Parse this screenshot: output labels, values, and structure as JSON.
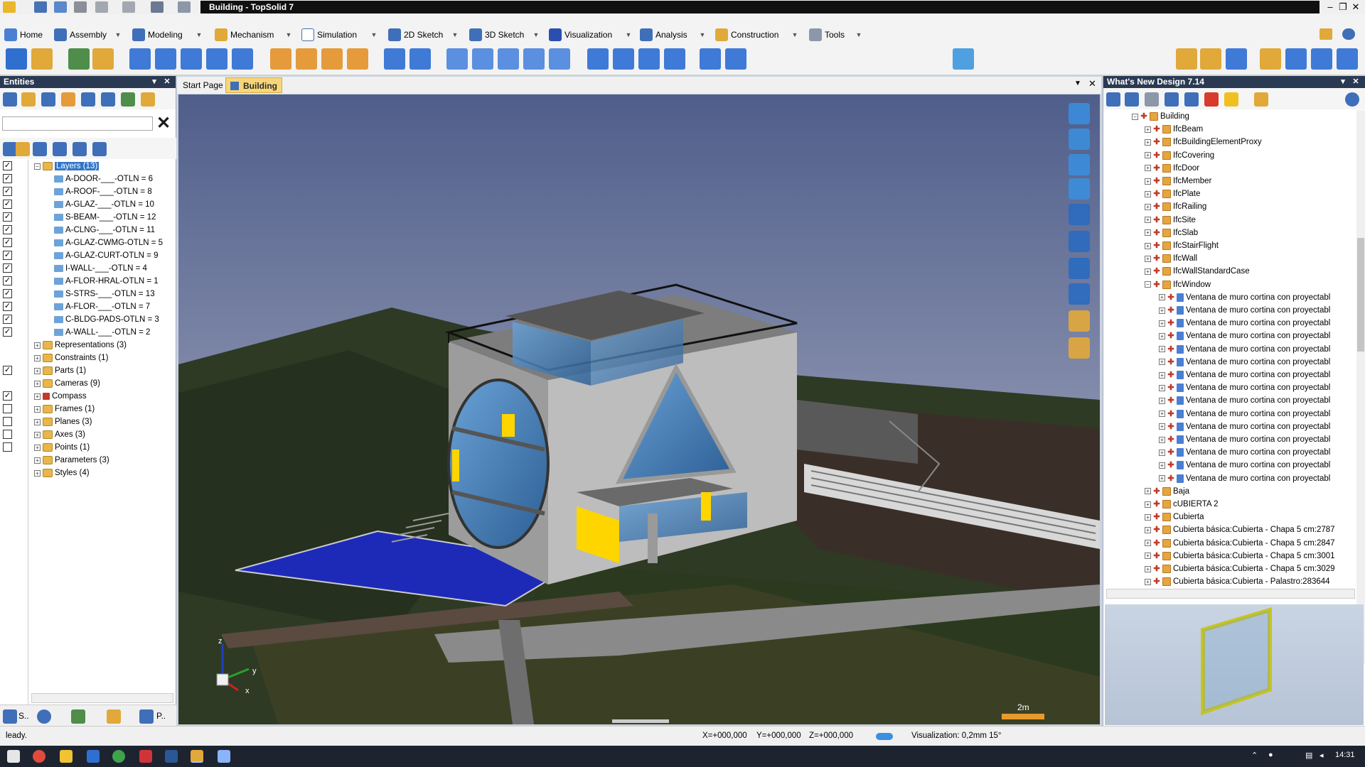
{
  "window": {
    "title": "Building - TopSolid 7",
    "controls": [
      "–",
      "❐",
      "✕"
    ]
  },
  "ribbon": {
    "tabs": [
      {
        "label": "Home"
      },
      {
        "label": "Assembly"
      },
      {
        "label": "Modeling"
      },
      {
        "label": "Mechanism"
      },
      {
        "label": "Simulation"
      },
      {
        "label": "2D Sketch"
      },
      {
        "label": "3D Sketch"
      },
      {
        "label": "Visualization"
      },
      {
        "label": "Analysis"
      },
      {
        "label": "Construction"
      },
      {
        "label": "Tools"
      }
    ]
  },
  "entities_panel": {
    "title": "Entities",
    "search_value": "",
    "tree": [
      {
        "label": "Layers (13)",
        "type": "folder",
        "expanded": true,
        "selected": true,
        "checked": true
      },
      {
        "label": "A-DOOR-___-OTLN = 6",
        "type": "layer",
        "checked": true
      },
      {
        "label": "A-ROOF-___-OTLN = 8",
        "type": "layer",
        "checked": true
      },
      {
        "label": "A-GLAZ-___-OTLN = 10",
        "type": "layer",
        "checked": true
      },
      {
        "label": "S-BEAM-___-OTLN = 12",
        "type": "layer",
        "checked": true
      },
      {
        "label": "A-CLNG-___-OTLN = 11",
        "type": "layer",
        "checked": true
      },
      {
        "label": "A-GLAZ-CWMG-OTLN = 5",
        "type": "layer",
        "checked": true
      },
      {
        "label": "A-GLAZ-CURT-OTLN = 9",
        "type": "layer",
        "checked": true
      },
      {
        "label": "I-WALL-___-OTLN = 4",
        "type": "layer",
        "checked": true
      },
      {
        "label": "A-FLOR-HRAL-OTLN = 1",
        "type": "layer",
        "checked": true
      },
      {
        "label": "S-STRS-___-OTLN = 13",
        "type": "layer",
        "checked": true
      },
      {
        "label": "A-FLOR-___-OTLN = 7",
        "type": "layer",
        "checked": true
      },
      {
        "label": "C-BLDG-PADS-OTLN = 3",
        "type": "layer",
        "checked": true
      },
      {
        "label": "A-WALL-___-OTLN = 2",
        "type": "layer",
        "checked": true
      },
      {
        "label": "Representations (3)",
        "type": "folder",
        "checked": null
      },
      {
        "label": "Constraints (1)",
        "type": "folder",
        "checked": null
      },
      {
        "label": "Parts (1)",
        "type": "folder",
        "checked": true
      },
      {
        "label": "Cameras (9)",
        "type": "folder",
        "checked": null
      },
      {
        "label": "Compass",
        "type": "compass",
        "checked": true
      },
      {
        "label": "Frames (1)",
        "type": "folder",
        "checked": false
      },
      {
        "label": "Planes (3)",
        "type": "folder",
        "checked": false
      },
      {
        "label": "Axes (3)",
        "type": "folder",
        "checked": false
      },
      {
        "label": "Points (1)",
        "type": "folder",
        "checked": false
      },
      {
        "label": "Parameters (3)",
        "type": "folder",
        "checked": null
      },
      {
        "label": "Styles (4)",
        "type": "folder",
        "checked": null
      }
    ],
    "bottom_tabs": [
      "S..",
      "...",
      "...",
      "...",
      "P.."
    ]
  },
  "document_tabs": [
    {
      "label": "Start Page",
      "active": false
    },
    {
      "label": "Building",
      "active": true
    }
  ],
  "right_panel": {
    "title": "What's New Design 7.14",
    "tree": [
      {
        "label": "Building",
        "level": 0,
        "kind": "ifc"
      },
      {
        "label": "IfcBeam",
        "level": 1,
        "kind": "ifc"
      },
      {
        "label": "IfcBuildingElementProxy",
        "level": 1,
        "kind": "ifc"
      },
      {
        "label": "IfcCovering",
        "level": 1,
        "kind": "ifc"
      },
      {
        "label": "IfcDoor",
        "level": 1,
        "kind": "ifc"
      },
      {
        "label": "IfcMember",
        "level": 1,
        "kind": "ifc"
      },
      {
        "label": "IfcPlate",
        "level": 1,
        "kind": "ifc"
      },
      {
        "label": "IfcRailing",
        "level": 1,
        "kind": "ifc"
      },
      {
        "label": "IfcSite",
        "level": 1,
        "kind": "ifc"
      },
      {
        "label": "IfcSlab",
        "level": 1,
        "kind": "ifc"
      },
      {
        "label": "IfcStairFlight",
        "level": 1,
        "kind": "ifc"
      },
      {
        "label": "IfcWall",
        "level": 1,
        "kind": "ifc"
      },
      {
        "label": "IfcWallStandardCase",
        "level": 1,
        "kind": "ifc"
      },
      {
        "label": "IfcWindow",
        "level": 1,
        "kind": "ifc"
      },
      {
        "label": "Ventana de muro cortina con proyectabl",
        "level": 2,
        "kind": "obj"
      },
      {
        "label": "Ventana de muro cortina con proyectabl",
        "level": 2,
        "kind": "obj"
      },
      {
        "label": "Ventana de muro cortina con proyectabl",
        "level": 2,
        "kind": "obj"
      },
      {
        "label": "Ventana de muro cortina con proyectabl",
        "level": 2,
        "kind": "obj"
      },
      {
        "label": "Ventana de muro cortina con proyectabl",
        "level": 2,
        "kind": "obj"
      },
      {
        "label": "Ventana de muro cortina con proyectabl",
        "level": 2,
        "kind": "obj"
      },
      {
        "label": "Ventana de muro cortina con proyectabl",
        "level": 2,
        "kind": "obj"
      },
      {
        "label": "Ventana de muro cortina con proyectabl",
        "level": 2,
        "kind": "obj"
      },
      {
        "label": "Ventana de muro cortina con proyectabl",
        "level": 2,
        "kind": "obj"
      },
      {
        "label": "Ventana de muro cortina con proyectabl",
        "level": 2,
        "kind": "obj"
      },
      {
        "label": "Ventana de muro cortina con proyectabl",
        "level": 2,
        "kind": "obj"
      },
      {
        "label": "Ventana de muro cortina con proyectabl",
        "level": 2,
        "kind": "obj"
      },
      {
        "label": "Ventana de muro cortina con proyectabl",
        "level": 2,
        "kind": "obj"
      },
      {
        "label": "Ventana de muro cortina con proyectabl",
        "level": 2,
        "kind": "obj"
      },
      {
        "label": "Ventana de muro cortina con proyectabl",
        "level": 2,
        "kind": "obj"
      },
      {
        "label": "Baja",
        "level": 1,
        "kind": "ifc"
      },
      {
        "label": "cUBIERTA 2",
        "level": 1,
        "kind": "ifc"
      },
      {
        "label": "Cubierta",
        "level": 1,
        "kind": "ifc"
      },
      {
        "label": "Cubierta básica:Cubierta - Chapa 5 cm:2787",
        "level": 1,
        "kind": "ifc"
      },
      {
        "label": "Cubierta básica:Cubierta - Chapa 5 cm:2847",
        "level": 1,
        "kind": "ifc"
      },
      {
        "label": "Cubierta básica:Cubierta - Chapa 5 cm:3001",
        "level": 1,
        "kind": "ifc"
      },
      {
        "label": "Cubierta básica:Cubierta - Chapa 5 cm:3029",
        "level": 1,
        "kind": "ifc"
      },
      {
        "label": "Cubierta básica:Cubierta - Palastro:283644",
        "level": 1,
        "kind": "ifc"
      }
    ]
  },
  "viewport": {
    "scale_label": "2m",
    "axis_labels": {
      "z": "z",
      "y": "y",
      "x": "x"
    }
  },
  "status": {
    "message": "leady.",
    "x": "X=+000,000",
    "y": "Y=+000,000",
    "z": "Z=+000,000",
    "visualization": "Visualization: 0,2mm 15°"
  },
  "taskbar": {
    "time": "14:31"
  },
  "colors": {
    "panel_header": "#2b3a53",
    "selection": "#3275c9",
    "active_tab": "#f7d67b"
  }
}
